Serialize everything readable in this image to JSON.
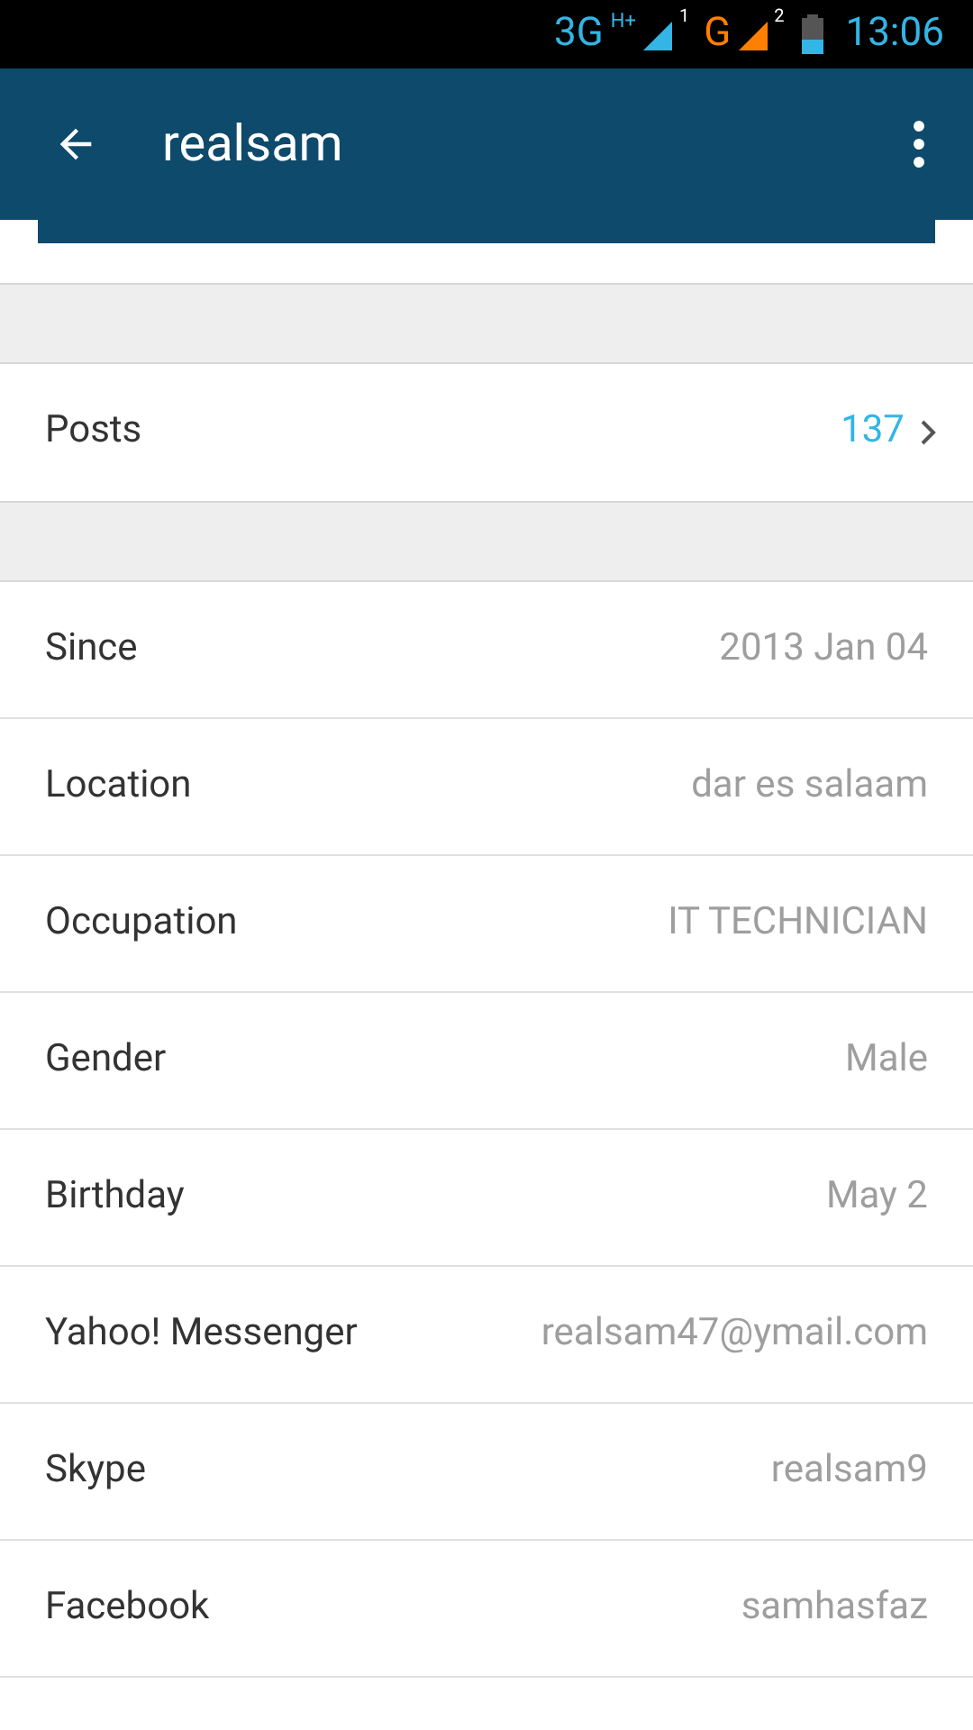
{
  "status_bar": {
    "sim1_network": "3G",
    "sim1_badge": "H+",
    "sim1_index": "1",
    "sim2_network": "G",
    "sim2_index": "2",
    "time": "13:06"
  },
  "app_bar": {
    "title": "realsam"
  },
  "posts": {
    "label": "Posts",
    "count": "137"
  },
  "details": [
    {
      "label": "Since",
      "value": "2013 Jan 04"
    },
    {
      "label": "Location",
      "value": "dar es salaam"
    },
    {
      "label": "Occupation",
      "value": "IT TECHNICIAN"
    },
    {
      "label": "Gender",
      "value": "Male"
    },
    {
      "label": "Birthday",
      "value": "May 2"
    },
    {
      "label": "Yahoo! Messenger",
      "value": "realsam47@ymail.com"
    },
    {
      "label": "Skype",
      "value": "realsam9"
    },
    {
      "label": "Facebook",
      "value": "samhasfaz"
    }
  ]
}
